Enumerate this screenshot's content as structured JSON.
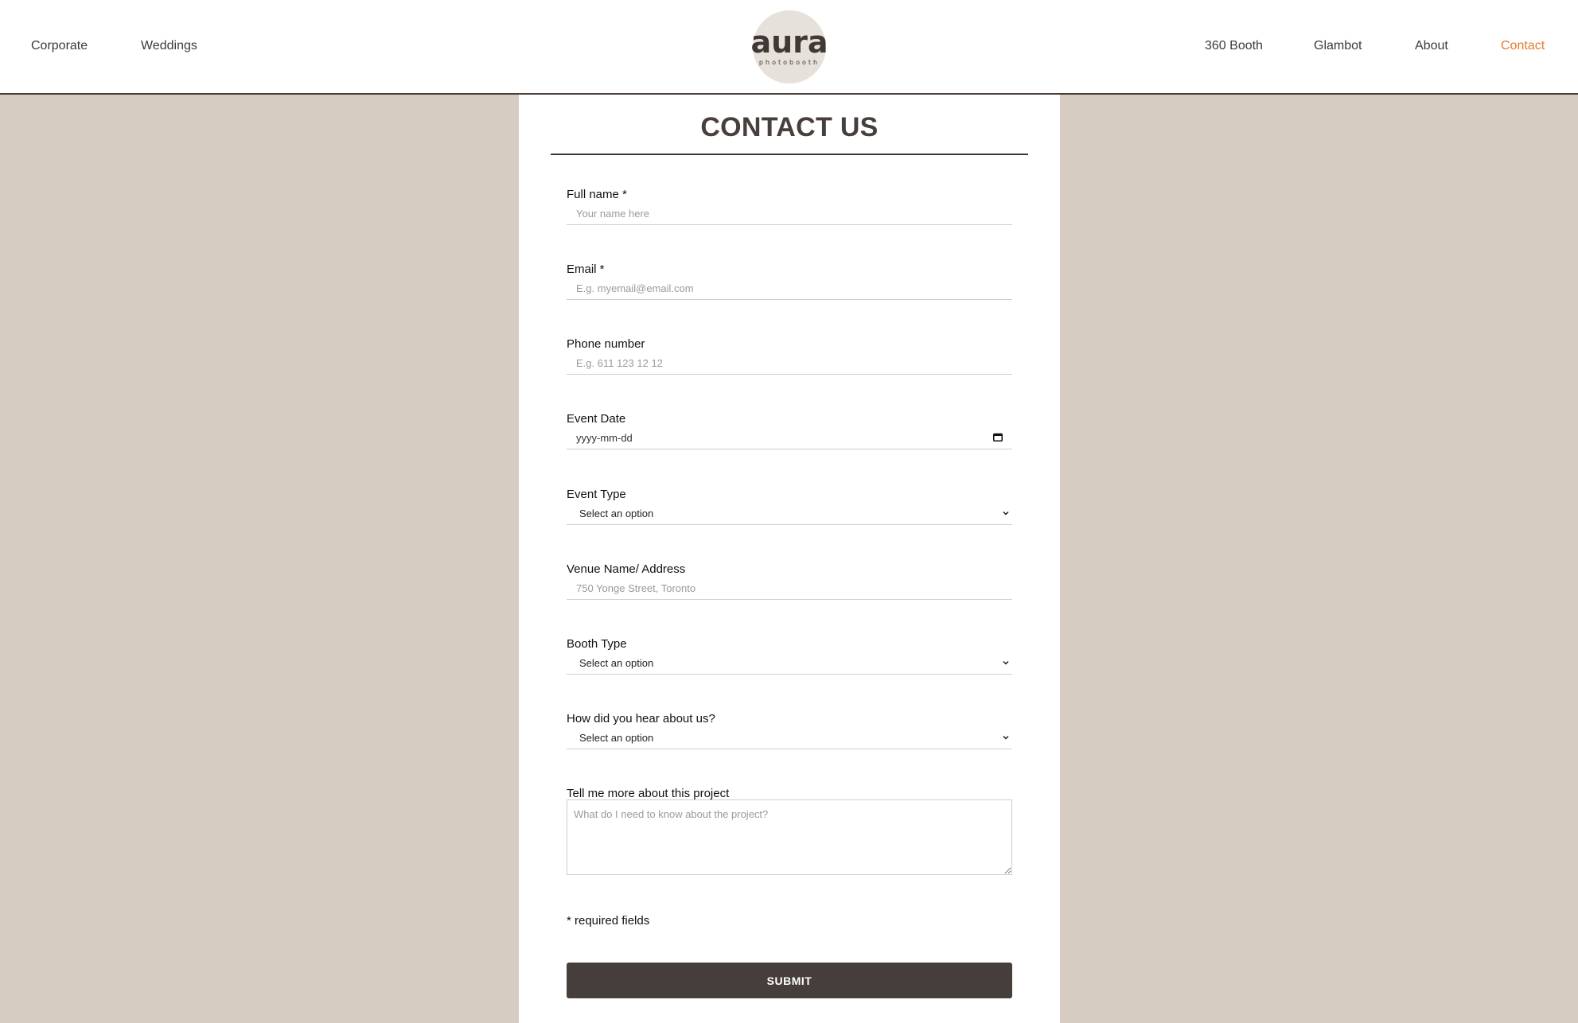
{
  "nav": {
    "left": [
      "Corporate",
      "Weddings"
    ],
    "right": [
      "360 Booth",
      "Glambot",
      "About",
      "Contact"
    ],
    "active": "Contact",
    "active_color": "#e8792e"
  },
  "logo": {
    "word": "aura",
    "sub": "photobooth"
  },
  "page_title": "CONTACT US",
  "fields": {
    "full_name": {
      "label": "Full name *",
      "placeholder": "Your name here"
    },
    "email": {
      "label": "Email *",
      "placeholder": "E.g. myemail@email.com"
    },
    "phone": {
      "label": "Phone number",
      "placeholder": "E.g. 611 123 12 12"
    },
    "event_date": {
      "label": "Event Date",
      "value": "yyyy-mm-dd"
    },
    "event_type": {
      "label": "Event Type",
      "value": "Select an option"
    },
    "venue": {
      "label": "Venue Name/ Address",
      "placeholder": "750 Yonge Street, Toronto"
    },
    "booth_type": {
      "label": "Booth Type",
      "value": "Select an option"
    },
    "heard": {
      "label": "How did you hear about us?",
      "value": "Select an option"
    },
    "project": {
      "label": "Tell me more about this project",
      "placeholder": "What do I need to know about the project?"
    }
  },
  "required_note": "* required fields",
  "submit_label": "SUBMIT",
  "colors": {
    "background": "#d6ccc2",
    "panel": "#ffffff",
    "button": "#463e3b",
    "logo_circle": "#e6e1da"
  }
}
